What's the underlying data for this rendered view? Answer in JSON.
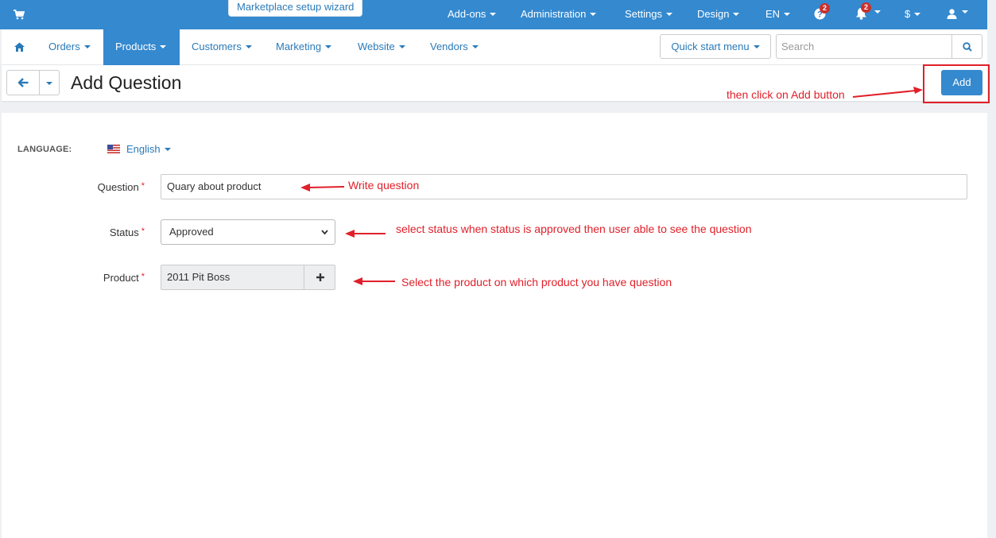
{
  "topbar": {
    "wizard_label": "Marketplace setup wizard",
    "menus": [
      {
        "label": "Add-ons"
      },
      {
        "label": "Administration"
      },
      {
        "label": "Settings"
      },
      {
        "label": "Design"
      },
      {
        "label": "EN"
      }
    ],
    "help_badge": "2",
    "notifications_badge": "2",
    "currency_label": "$",
    "icons": [
      "cart-icon",
      "question-icon",
      "bell-icon",
      "user-icon"
    ]
  },
  "nav": {
    "items": [
      {
        "label": "Orders",
        "active": false
      },
      {
        "label": "Products",
        "active": true
      },
      {
        "label": "Customers",
        "active": false
      },
      {
        "label": "Marketing",
        "active": false
      },
      {
        "label": "Website",
        "active": false
      },
      {
        "label": "Vendors",
        "active": false
      }
    ],
    "quick_start_label": "Quick start menu",
    "search_placeholder": "Search"
  },
  "page": {
    "title": "Add Question",
    "add_button_label": "Add"
  },
  "form": {
    "language_label": "LANGUAGE:",
    "language_value": "English",
    "question_label": "Question",
    "question_value": "Quary about product",
    "status_label": "Status",
    "status_value": "Approved",
    "product_label": "Product",
    "product_value": "2011 Pit Boss",
    "required_mark": "*"
  },
  "annotations": {
    "add": "then click on Add button",
    "question": "Write question",
    "status": "select status when status is approved then user able to see the question",
    "product": "Select the product on which product you have question"
  },
  "colors": {
    "brand": "#3489cf",
    "annotation": "#e0202a"
  }
}
